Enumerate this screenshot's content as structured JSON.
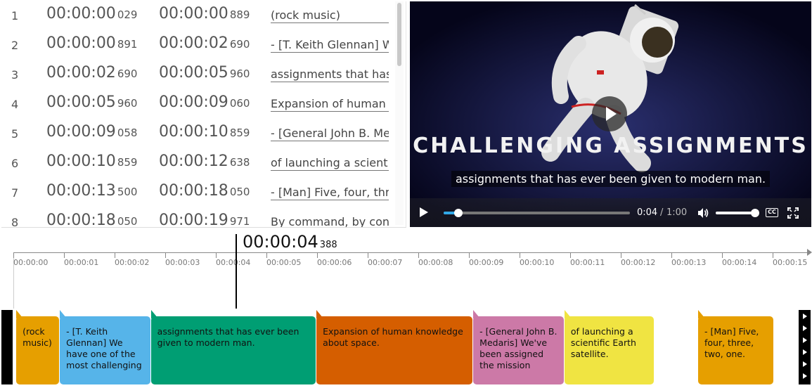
{
  "subtitles": [
    {
      "index": "1",
      "start": "00:00:00",
      "start_ms": "029",
      "end": "00:00:00",
      "end_ms": "889",
      "text": "(rock music)"
    },
    {
      "index": "2",
      "start": "00:00:00",
      "start_ms": "891",
      "end": "00:00:02",
      "end_ms": "690",
      "text": "- [T. Keith Glennan] We have one of the most challenging"
    },
    {
      "index": "3",
      "start": "00:00:02",
      "start_ms": "690",
      "end": "00:00:05",
      "end_ms": "960",
      "text": "assignments that has ever been given to modern man."
    },
    {
      "index": "4",
      "start": "00:00:05",
      "start_ms": "960",
      "end": "00:00:09",
      "end_ms": "060",
      "text": "Expansion of human knowledge about space."
    },
    {
      "index": "5",
      "start": "00:00:09",
      "start_ms": "058",
      "end": "00:00:10",
      "end_ms": "859",
      "text": "- [General John B. Medaris] We've been assigned the mission"
    },
    {
      "index": "6",
      "start": "00:00:10",
      "start_ms": "859",
      "end": "00:00:12",
      "end_ms": "638",
      "text": "of launching a scientific Earth satellite."
    },
    {
      "index": "7",
      "start": "00:00:13",
      "start_ms": "500",
      "end": "00:00:18",
      "end_ms": "050",
      "text": "- [Man] Five, four, three, two, one."
    },
    {
      "index": "8",
      "start": "00:00:18",
      "start_ms": "050",
      "end": "00:00:19",
      "end_ms": "971",
      "text": "By command, by con"
    }
  ],
  "video": {
    "title_overlay": "CHALLENGING ASSIGNMENTS",
    "caption": "assignments that has ever been given to modern man.",
    "current_time": "0:04",
    "separator": "/",
    "duration": "1:00",
    "progress_fraction": 0.078,
    "volume_fraction": 1.0,
    "cc_label": "CC",
    "icons": [
      "play-icon",
      "volume-icon",
      "cc-icon",
      "fullscreen-icon"
    ]
  },
  "timeline": {
    "cursor": {
      "time": "00:00:04",
      "ms": "388"
    },
    "ticks": [
      "00:00:00",
      "00:00:01",
      "00:00:02",
      "00:00:03",
      "00:00:04",
      "00:00:05",
      "00:00:06",
      "00:00:07",
      "00:00:08",
      "00:00:09",
      "00:00:10",
      "00:00:11",
      "00:00:12",
      "00:00:13",
      "00:00:14",
      "00:00:15"
    ],
    "blocks": [
      {
        "text": "(rock music)",
        "start": 0.029,
        "end": 0.889,
        "color": "#e69f00"
      },
      {
        "text": "- [T. Keith Glennan] We have one of the most challenging",
        "start": 0.891,
        "end": 2.69,
        "color": "#56b4e9"
      },
      {
        "text": "assignments that has ever been given to modern man.",
        "start": 2.69,
        "end": 5.96,
        "color": "#009e73"
      },
      {
        "text": "Expansion of human knowledge about space.",
        "start": 5.96,
        "end": 9.06,
        "color": "#d55e00"
      },
      {
        "text": "- [General John B. Medaris] We've been assigned the mission",
        "start": 9.058,
        "end": 10.859,
        "color": "#cc79a7"
      },
      {
        "text": "of launching a scientific Earth satellite.",
        "start": 10.859,
        "end": 12.638,
        "color": "#f0e442"
      },
      {
        "text": "- [Man] Five, four, three, two, one.",
        "start": 13.5,
        "end": 15.0,
        "color": "#e69f00"
      }
    ]
  }
}
